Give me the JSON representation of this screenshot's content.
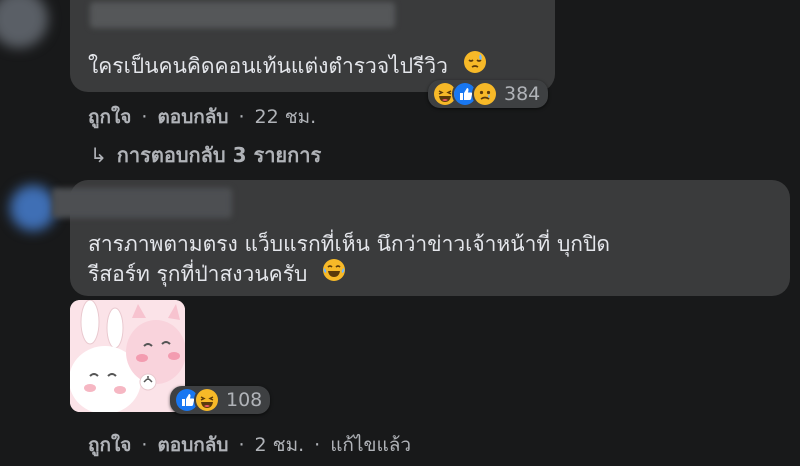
{
  "comment1": {
    "text": "ใครเป็นคนคิดคอนเท้นแต่งตำรวจไปรีวิว",
    "reaction_count": "384",
    "actions": {
      "like": "ถูกใจ",
      "reply": "ตอบกลับ",
      "time": "22 ชม."
    },
    "replies_label": "การตอบกลับ 3 รายการ",
    "reactions": [
      "haha-icon",
      "like-icon",
      "sad-icon"
    ]
  },
  "comment2": {
    "line1": "สารภาพตามตรง แว็บแรกที่เห็น นึกว่าข่าวเจ้าหน้าที่ บุกปิด",
    "line2": "รีสอร์ท รุกที่ป่าสงวนครับ",
    "sticker_reaction_count": "108",
    "actions": {
      "like": "ถูกใจ",
      "reply": "ตอบกลับ",
      "time": "2 ชม.",
      "edited": "แก้ไขแล้ว"
    },
    "reactions": [
      "like-icon",
      "haha-icon"
    ]
  },
  "colors": {
    "background": "#18191a",
    "bubble": "#3a3b3c",
    "text": "#e4e6eb",
    "secondary": "#b0b3b8",
    "like_blue": "#1877f2",
    "emoji_yellow": "#f7b928"
  }
}
